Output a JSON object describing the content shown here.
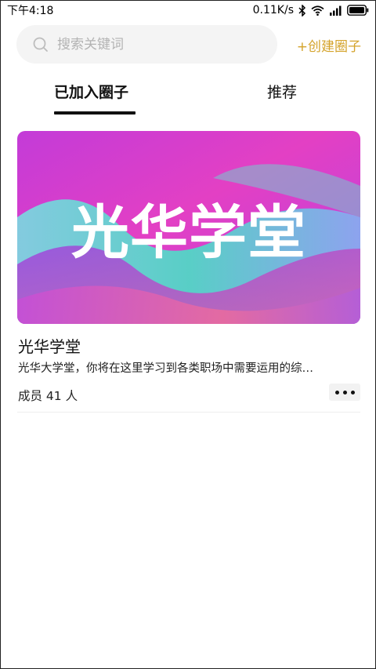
{
  "status_bar": {
    "time": "下午4:18",
    "net_speed": "0.11K/s"
  },
  "search": {
    "placeholder": "搜索关键词",
    "value": ""
  },
  "create_button": "+创建圈子",
  "tabs": [
    {
      "label": "已加入圈子",
      "active": true
    },
    {
      "label": "推荐",
      "active": false
    }
  ],
  "circles": [
    {
      "banner_text": "光华学堂",
      "title": "光华学堂",
      "description": "光华大学堂，你将在这里学习到各类职场中需要运用的综…",
      "members": "成员 41 人"
    }
  ],
  "colors": {
    "accent": "#d4a32b",
    "banner_magenta": "#d93ad6",
    "banner_teal": "#4fd3cc"
  }
}
